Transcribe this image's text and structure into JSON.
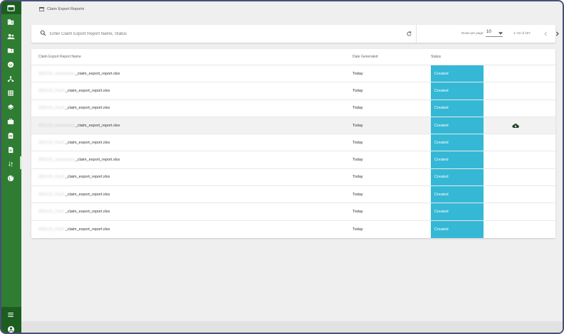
{
  "page": {
    "title": "Claim Export Reports"
  },
  "search": {
    "placeholder": "Enter Claim Export Report Name, Status"
  },
  "pagination": {
    "rows_per_page_label": "Rows per page:",
    "rows_per_page_value": "10",
    "range_text": "1–10 of 157"
  },
  "table": {
    "headers": {
      "name": "Claim Export Report Name",
      "date": "Date Generated",
      "status": "Status"
    },
    "rows": [
      {
        "prefix": "2023-01_xxxxxxxxxx",
        "name": "_claim_export_report.xlsx",
        "date": "Today",
        "status": "Created"
      },
      {
        "prefix": "2023-01_Finch",
        "name": "_claim_export_report.xlsx",
        "date": "Today",
        "status": "Created"
      },
      {
        "prefix": "2023-01_Finch",
        "name": "_claim_export_report.xlsx",
        "date": "Today",
        "status": "Created"
      },
      {
        "prefix": "2023-01_xxxxxxxxxx",
        "name": "_claim_export_report.xlsx",
        "date": "Today",
        "status": "Created",
        "download": true
      },
      {
        "prefix": "2023-01_Finch",
        "name": "_claim_export_report.xlsx",
        "date": "Today",
        "status": "Created"
      },
      {
        "prefix": "2023-01_xxxxxxxxxx",
        "name": "_claim_export_report.xlsx",
        "date": "Today",
        "status": "Created"
      },
      {
        "prefix": "2023-01_Finch",
        "name": "_claim_export_report.xlsx",
        "date": "Today",
        "status": "Created"
      },
      {
        "prefix": "2023-01_Finch",
        "name": "_claim_export_report.xlsx",
        "date": "Today",
        "status": "Created"
      },
      {
        "prefix": "2023-01_Finch",
        "name": "_claim_export_report.xlsx",
        "date": "Today",
        "status": "Created"
      },
      {
        "prefix": "2023-01_Finch",
        "name": "_claim_export_report.xlsx",
        "date": "Today",
        "status": "Created"
      }
    ]
  },
  "sidebar": {
    "icons": [
      "dashboard-icon",
      "business-icon",
      "people-icon",
      "folder-shared-icon",
      "face-icon",
      "hub-icon",
      "grid-icon",
      "layers-icon",
      "briefcase-icon",
      "clipboard-icon",
      "document-icon",
      "swap-vertical-icon",
      "globe-icon"
    ],
    "bottom_icons": [
      "menu-icon",
      "account-icon"
    ]
  },
  "colors": {
    "sidebar": "#2e7d32",
    "sidebar_dark": "#1b5e20",
    "status_created": "#35b8d6"
  }
}
